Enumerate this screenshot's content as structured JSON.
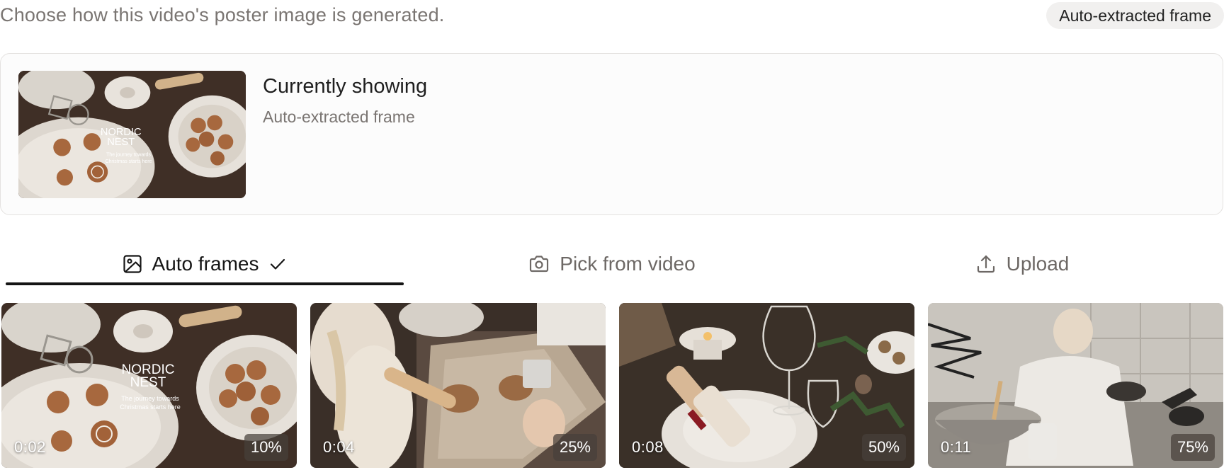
{
  "header": {
    "description": "Choose how this video's poster image is generated.",
    "mode_badge": "Auto-extracted frame"
  },
  "current": {
    "title": "Currently showing",
    "subtitle": "Auto-extracted frame",
    "thumb_brand": "NORDIC",
    "thumb_brand2": "NEST",
    "thumb_tagline1": "The journey towards",
    "thumb_tagline2": "Christmas starts here"
  },
  "tabs": [
    {
      "label": "Auto frames",
      "icon": "image-icon",
      "active": true,
      "check_icon": "check-icon"
    },
    {
      "label": "Pick from video",
      "icon": "camera-icon",
      "active": false
    },
    {
      "label": "Upload",
      "icon": "upload-icon",
      "active": false
    }
  ],
  "frames": [
    {
      "time": "0:02",
      "percent": "10%"
    },
    {
      "time": "0:04",
      "percent": "25%"
    },
    {
      "time": "0:08",
      "percent": "50%"
    },
    {
      "time": "0:11",
      "percent": "75%"
    }
  ],
  "colors": {
    "accent_underline": "#151515",
    "muted_text": "#7a7572",
    "badge_bg": "#f1f0ef",
    "card_border": "#e4e2e0"
  }
}
